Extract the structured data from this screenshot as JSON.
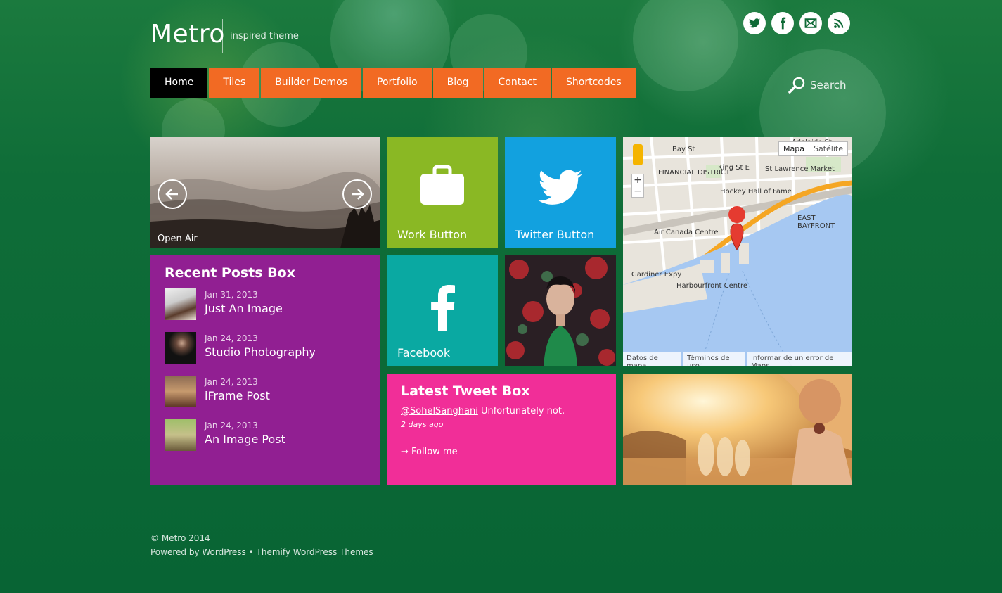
{
  "site": {
    "title": "Metro",
    "tagline": "inspired theme"
  },
  "social": [
    {
      "name": "twitter-icon"
    },
    {
      "name": "facebook-icon"
    },
    {
      "name": "email-icon"
    },
    {
      "name": "rss-icon"
    }
  ],
  "nav": {
    "items": [
      {
        "label": "Home",
        "active": true
      },
      {
        "label": "Tiles"
      },
      {
        "label": "Builder Demos"
      },
      {
        "label": "Portfolio"
      },
      {
        "label": "Blog"
      },
      {
        "label": "Contact"
      },
      {
        "label": "Shortcodes"
      }
    ]
  },
  "search": {
    "label": "Search"
  },
  "slider": {
    "caption": "Open Air"
  },
  "tiles": {
    "work": {
      "label": "Work Button",
      "color": "#8ab824"
    },
    "twitter": {
      "label": "Twitter Button",
      "color": "#12a1df"
    },
    "facebook": {
      "label": "Facebook",
      "color": "#0aa9a2"
    }
  },
  "recent_posts": {
    "title": "Recent Posts Box",
    "posts": [
      {
        "date": "Jan 31, 2013",
        "title": "Just An Image"
      },
      {
        "date": "Jan 24, 2013",
        "title": "Studio Photography"
      },
      {
        "date": "Jan 24, 2013",
        "title": "iFrame Post"
      },
      {
        "date": "Jan 24, 2013",
        "title": "An Image Post"
      }
    ]
  },
  "tweet": {
    "title": "Latest Tweet Box",
    "handle": "@SohelSanghani",
    "text": " Unfortunately not.",
    "time": "2 days ago",
    "follow": "→ Follow me"
  },
  "map": {
    "type_map": "Mapa",
    "type_satellite": "Satélite",
    "zoom_in": "+",
    "zoom_out": "−",
    "footer": [
      "Datos de mapa",
      "Términos de uso",
      "Informar de un error de Maps"
    ],
    "labels": [
      "FINANCIAL DISTRICT",
      "King St E",
      "St Lawrence Market",
      "Hockey Hall of Fame",
      "Air Canada Centre",
      "EAST BAYFRONT",
      "Gardiner Expy",
      "Harbourfront Centre",
      "Bay St",
      "Adelaide St"
    ]
  },
  "footer": {
    "copyright": "©",
    "site_link": "Metro",
    "year": " 2014",
    "powered_prefix": "Powered by ",
    "wordpress": "WordPress",
    "separator": " • ",
    "themify": "Themify WordPress Themes"
  },
  "colors": {
    "background": "#0b6a36",
    "nav": "#f26a23",
    "nav_active": "#000000",
    "recent_posts": "#911f92",
    "tweet": "#f12e98"
  }
}
